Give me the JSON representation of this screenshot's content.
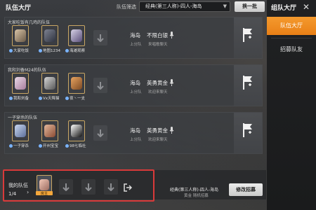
{
  "header": {
    "page_title": "队伍大厅",
    "filter_label": "队伍筛选",
    "filter_value": "经典(第三人称)-四人-海岛",
    "refresh_label": "换一批"
  },
  "right_panel": {
    "title": "组队大厅",
    "close": "✕",
    "tabs": [
      {
        "label": "队伍大厅",
        "active": true
      },
      {
        "label": "招募队友",
        "active": false
      }
    ]
  },
  "teams": [
    {
      "title": "大家吃饭有几鸡的队伍",
      "members": [
        {
          "name": "大家吃饭"
        },
        {
          "name": "地图1234"
        },
        {
          "name": "海滩观察"
        }
      ],
      "map": "海岛",
      "rank": "不限白银",
      "sub_label": "上分队",
      "sub_value": "来唱歌聊天"
    },
    {
      "title": "我和刘备M24的队伍",
      "members": [
        {
          "name": "我和刘备"
        },
        {
          "name": "Vx天降猫"
        },
        {
          "name": "夜丶一支"
        }
      ],
      "map": "海岛",
      "rank": "英勇黄金",
      "sub_label": "上分队",
      "sub_value": "欢迎来聊天"
    },
    {
      "title": "一子穿杀的队伍",
      "members": [
        {
          "name": "一子穿杀"
        },
        {
          "name": "开州宝宝"
        },
        {
          "name": "98七临社"
        }
      ],
      "map": "海岛",
      "rank": "英勇黄金",
      "sub_label": "上分队",
      "sub_value": "欢迎来聊天"
    }
  ],
  "my_team": {
    "label": "我的队伍",
    "count": "1/4",
    "chevron": "›",
    "avatar_tag": "房主",
    "mode_text": "经典(第三人称)-四人-海岛",
    "mode_sub": "黄金 随机招募",
    "edit_label": "修改招募"
  },
  "colors": {
    "accent": "#f08a1f",
    "highlight_border": "#d93a3a",
    "frame_gold": "#c9a764"
  },
  "icons": [
    "chevron-down-icon",
    "close-icon",
    "mic-icon",
    "add-member-icon",
    "join-flag-icon",
    "exit-icon"
  ]
}
